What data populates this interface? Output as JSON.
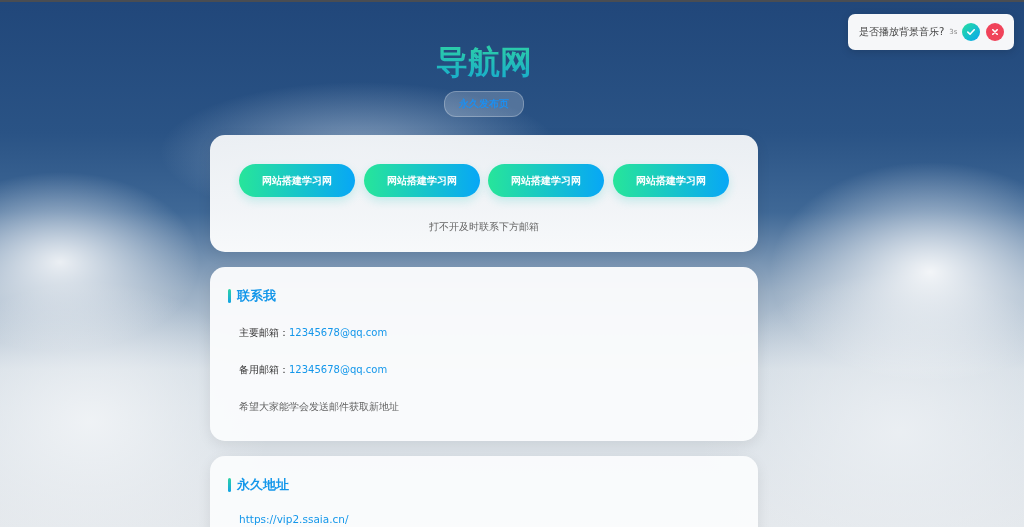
{
  "header": {
    "title": "导航网",
    "badge": "永久发布页"
  },
  "links_card": {
    "buttons": [
      "网站搭建学习网",
      "网站搭建学习网",
      "网站搭建学习网",
      "网站搭建学习网"
    ],
    "note": "打不开及时联系下方邮箱"
  },
  "contact": {
    "heading": "联系我",
    "emails": [
      {
        "label": "主要邮箱：",
        "address": "12345678@qq.com"
      },
      {
        "label": "备用邮箱：",
        "address": "12345678@qq.com"
      }
    ],
    "note": "希望大家能学会发送邮件获取新地址"
  },
  "permanent": {
    "heading": "永久地址",
    "url": "https://vip2.ssaia.cn/"
  },
  "music_prompt": {
    "question": "是否播放背景音乐?",
    "countdown": "3s"
  }
}
